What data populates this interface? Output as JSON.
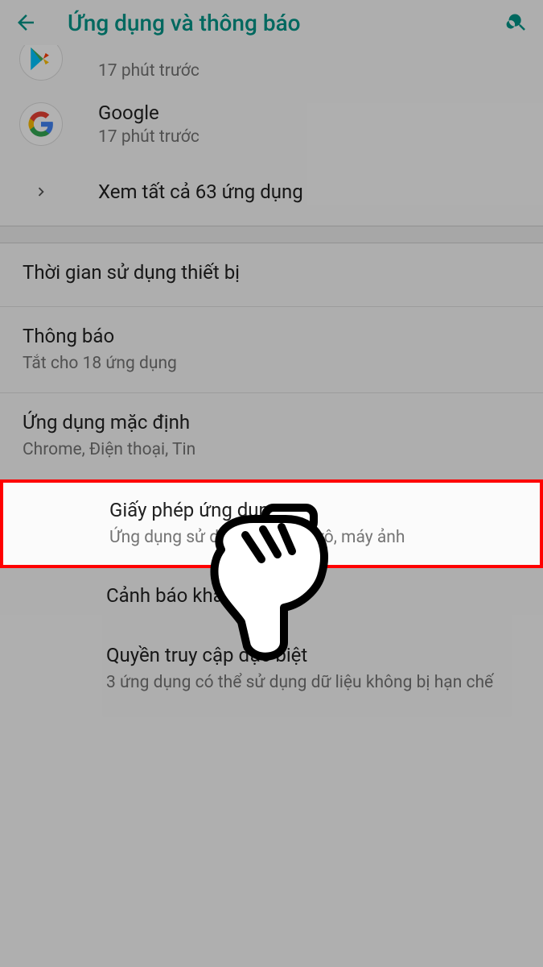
{
  "header": {
    "title": "Ứng dụng và thông báo"
  },
  "recent_apps": [
    {
      "name": "",
      "subtitle": "17 phút trước",
      "icon": "play-store"
    },
    {
      "name": "Google",
      "subtitle": "17 phút trước",
      "icon": "google"
    }
  ],
  "see_all": "Xem tất cả 63 ứng dụng",
  "rows": {
    "screen_time": {
      "title": "Thời gian sử dụng thiết bị"
    },
    "notifications": {
      "title": "Thông báo",
      "sub": "Tắt cho 18 ứng dụng"
    },
    "default_apps": {
      "title": "Ứng dụng mặc định",
      "sub": "Chrome, Điện thoại, Tin"
    },
    "permissions": {
      "title": "Giấy phép ứng dụng",
      "sub": "Ứng dụng sử dụng vị trí, micrô, máy ảnh"
    },
    "emergency": {
      "title": "Cảnh báo khẩn cấp"
    },
    "special": {
      "title": "Quyền truy cập đặc biệt",
      "sub": "3 ứng dụng có thể sử dụng dữ liệu không bị hạn chế"
    }
  }
}
